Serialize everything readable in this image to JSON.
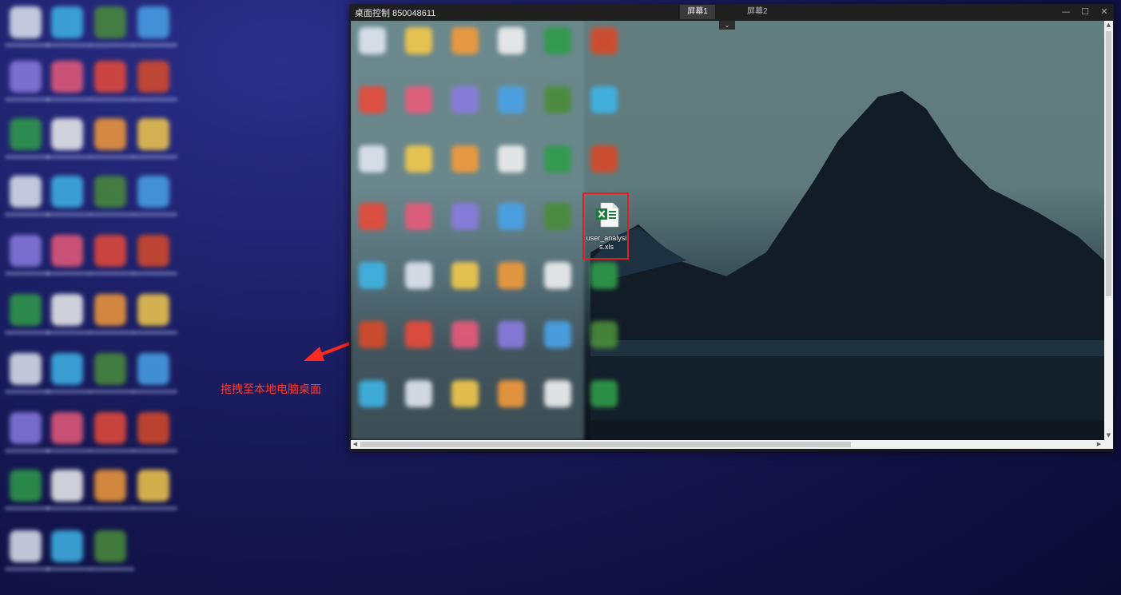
{
  "window": {
    "title": "桌面控制 850048611",
    "tabs": [
      {
        "label": "屏幕1",
        "active": true
      },
      {
        "label": "屏幕2",
        "active": false
      }
    ],
    "controls": {
      "minimize": "—",
      "maximize": "☐",
      "close": "✕"
    },
    "dropdown": "⌄"
  },
  "remote_desktop": {
    "file": {
      "name": "user_analysis.xls",
      "icon": "excel-icon",
      "highlight_color": "#e02020"
    }
  },
  "annotation": {
    "text": "拖拽至本地电脑桌面",
    "color": "#ff3a2e"
  },
  "scrollbars": {
    "up": "▲",
    "down": "▼",
    "left": "◀",
    "right": "▶"
  }
}
